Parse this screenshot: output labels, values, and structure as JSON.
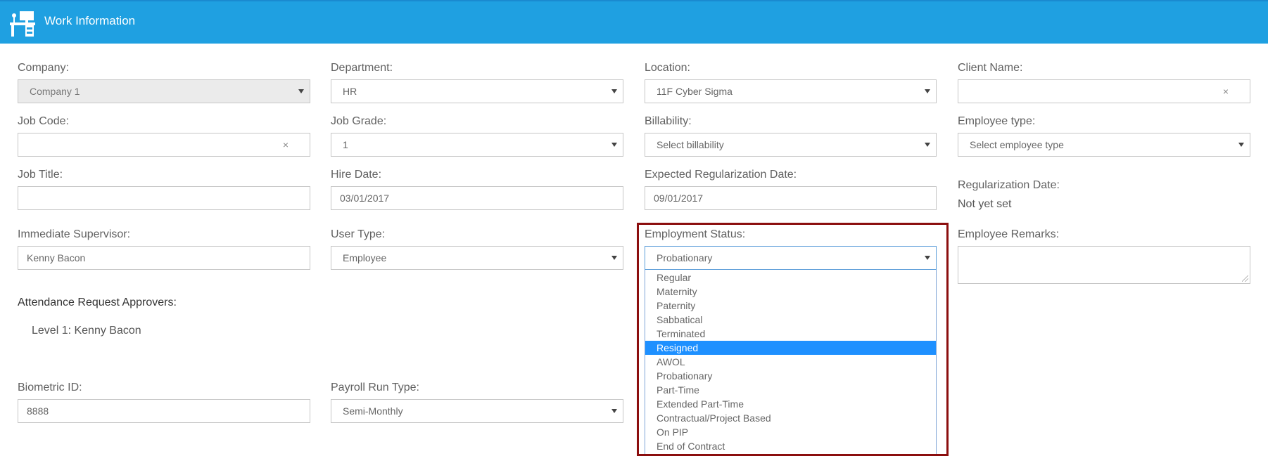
{
  "header": {
    "title": "Work Information",
    "icon": "desk-icon",
    "color": "#1fa0e1"
  },
  "fields": {
    "company": {
      "label": "Company:",
      "value": "Company 1"
    },
    "department": {
      "label": "Department:",
      "value": "HR"
    },
    "location": {
      "label": "Location:",
      "value": "11F Cyber Sigma"
    },
    "client_name": {
      "label": "Client Name:",
      "value": "",
      "clear": "×"
    },
    "job_code": {
      "label": "Job Code:",
      "value": "",
      "clear": "×"
    },
    "job_grade": {
      "label": "Job Grade:",
      "value": "1"
    },
    "billability": {
      "label": "Billability:",
      "value": "Select billability"
    },
    "employee_type": {
      "label": "Employee type:",
      "value": "Select employee type"
    },
    "job_title": {
      "label": "Job Title:",
      "value": ""
    },
    "hire_date": {
      "label": "Hire Date:",
      "value": "03/01/2017"
    },
    "expected_regularization_date": {
      "label": "Expected Regularization Date:",
      "value": "09/01/2017"
    },
    "regularization_date": {
      "label": "Regularization Date:",
      "value": "Not yet set"
    },
    "immediate_supervisor": {
      "label": "Immediate Supervisor:",
      "value": "Kenny Bacon"
    },
    "user_type": {
      "label": "User Type:",
      "value": "Employee"
    },
    "employment_status": {
      "label": "Employment Status:",
      "value": "Probationary"
    },
    "employee_remarks": {
      "label": "Employee Remarks:",
      "value": ""
    },
    "biometric_id": {
      "label": "Biometric ID:",
      "value": "8888"
    },
    "payroll_run_type": {
      "label": "Payroll Run Type:",
      "value": "Semi-Monthly"
    }
  },
  "attendance": {
    "heading": "Attendance Request Approvers:",
    "level1": "Level 1: Kenny Bacon"
  },
  "employment_status_dropdown": {
    "options": [
      "Regular",
      "Maternity",
      "Paternity",
      "Sabbatical",
      "Terminated",
      "Resigned",
      "AWOL",
      "Probationary",
      "Part-Time",
      "Extended Part-Time",
      "Contractual/Project Based",
      "On PIP",
      "End of Contract"
    ],
    "highlighted": "Resigned",
    "highlight_color": "#1e90ff",
    "frame_color": "#8b0e0e"
  }
}
